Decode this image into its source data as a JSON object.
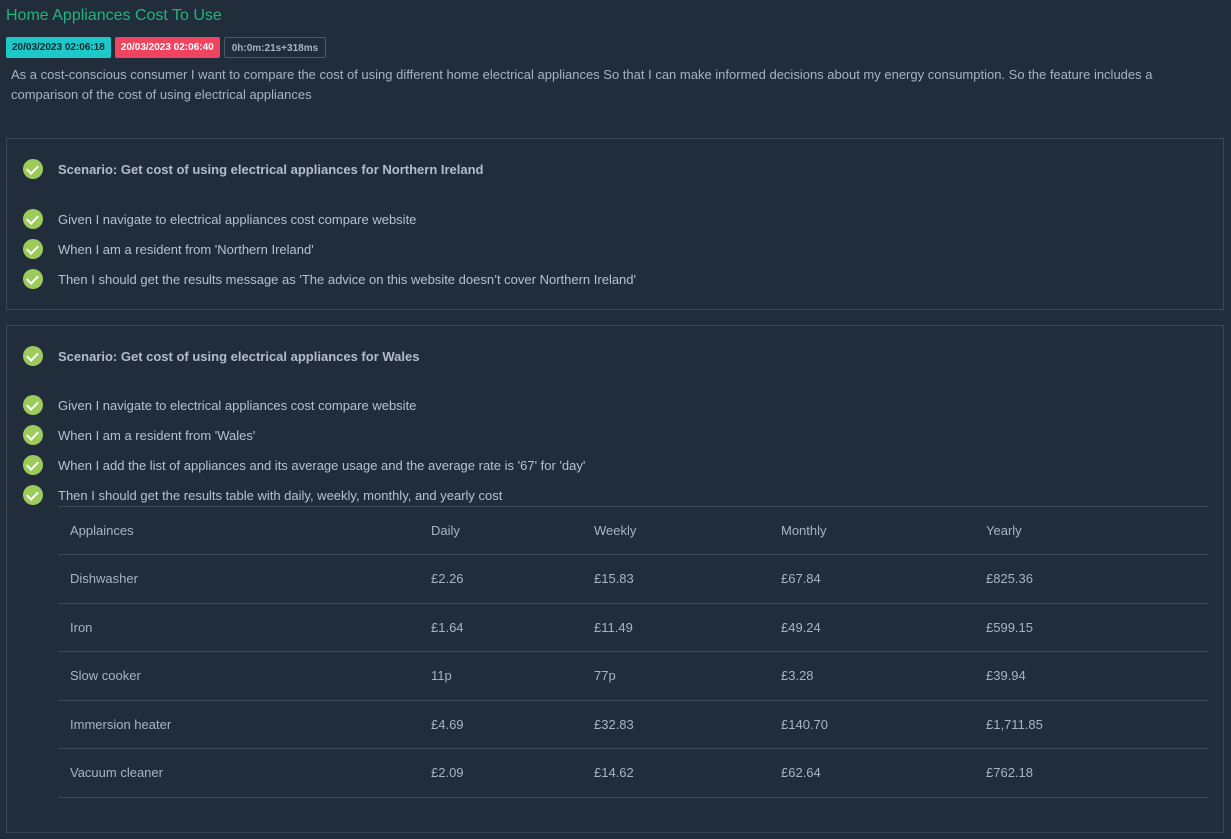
{
  "feature": {
    "title": "Home Appliances Cost To Use",
    "start_time": "20/03/2023 02:06:18",
    "end_time": "20/03/2023 02:06:40",
    "duration": "0h:0m:21s+318ms",
    "description": "As a cost-conscious consumer I want to compare the cost of using different home electrical appliances So that I can make informed decisions about my energy consumption. So the feature includes a comparison of the cost of using electrical appliances"
  },
  "colors": {
    "background": "#222d3c",
    "title": "#1fb57a",
    "start_badge": "#1ec8c8",
    "end_badge": "#f0435f",
    "passed": "#9ccb5c"
  },
  "scenarios": [
    {
      "title": "Scenario: Get cost of using electrical appliances for Northern Ireland",
      "status": "passed",
      "steps": [
        "Given I navigate to electrical appliances cost compare website",
        "When I am a resident from 'Northern Ireland'",
        "Then I should get the results message as 'The advice on this website doesn’t cover Northern Ireland'"
      ]
    },
    {
      "title": "Scenario: Get cost of using electrical appliances for Wales",
      "status": "passed",
      "steps": [
        "Given I navigate to electrical appliances cost compare website",
        "When I am a resident from 'Wales'",
        "When I add the list of appliances and its average usage and the average rate is '67' for 'day'",
        "Then I should get the results table with daily, weekly, monthly, and yearly cost"
      ],
      "table": {
        "headers": [
          "Applainces",
          "Daily",
          "Weekly",
          "Monthly",
          "Yearly"
        ],
        "rows": [
          [
            "Dishwasher",
            "£2.26",
            "£15.83",
            "£67.84",
            "£825.36"
          ],
          [
            "Iron",
            "£1.64",
            "£11.49",
            "£49.24",
            "£599.15"
          ],
          [
            "Slow cooker",
            "11p",
            "77p",
            "£3.28",
            "£39.94"
          ],
          [
            "Immersion heater",
            "£4.69",
            "£32.83",
            "£140.70",
            "£1,711.85"
          ],
          [
            "Vacuum cleaner",
            "£2.09",
            "£14.62",
            "£62.64",
            "£762.18"
          ]
        ]
      }
    }
  ]
}
